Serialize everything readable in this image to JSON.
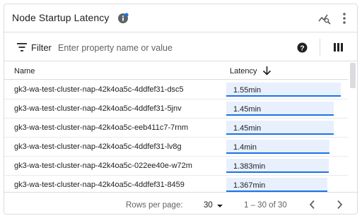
{
  "widget": {
    "title": "Node Startup Latency",
    "info_icon": "info-icon",
    "explore_icon": "explore-chart-icon",
    "more_icon": "more-vert-icon"
  },
  "filter": {
    "label": "Filter",
    "placeholder": "Enter property name or value",
    "value": "",
    "help_icon": "help-icon",
    "columns_icon": "column-picker-icon"
  },
  "table": {
    "columns": [
      "Name",
      "Latency"
    ],
    "sort": {
      "column": "Latency",
      "direction": "descending"
    },
    "bar_color": "#1a73e8",
    "bar_fill": "#e8f0fe",
    "max_latency_min": 1.55,
    "rows": [
      {
        "name": "gk3-wa-test-cluster-nap-42k4oa5c-4ddfef31-dsc5",
        "latency_label": "1.55min",
        "latency_min": 1.55
      },
      {
        "name": "gk3-wa-test-cluster-nap-42k4oa5c-4ddfef31-5jnv",
        "latency_label": "1.45min",
        "latency_min": 1.45
      },
      {
        "name": "gk3-wa-test-cluster-nap-42k4oa5c-eeb411c7-7rnm",
        "latency_label": "1.45min",
        "latency_min": 1.45
      },
      {
        "name": "gk3-wa-test-cluster-nap-42k4oa5c-4ddfef31-lv8g",
        "latency_label": "1.4min",
        "latency_min": 1.4
      },
      {
        "name": "gk3-wa-test-cluster-nap-42k4oa5c-022ee40e-w72m",
        "latency_label": "1.383min",
        "latency_min": 1.383
      },
      {
        "name": "gk3-wa-test-cluster-nap-42k4oa5c-4ddfef31-8459",
        "latency_label": "1.367min",
        "latency_min": 1.367
      }
    ]
  },
  "pagination": {
    "rows_per_page_label": "Rows per page:",
    "rows_per_page": "30",
    "range": "1 – 30 of 30",
    "prev_icon": "chevron-left-icon",
    "next_icon": "chevron-right-icon"
  }
}
